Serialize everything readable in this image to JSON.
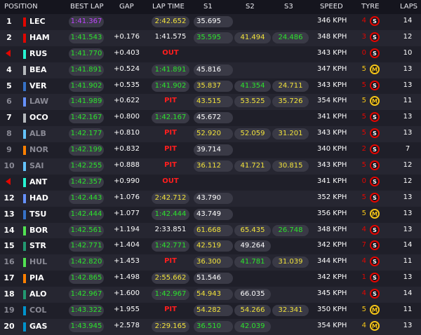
{
  "header": {
    "position": "POSITION",
    "best_lap": "BEST LAP",
    "gap": "GAP",
    "lap_time": "LAP TIME",
    "s1": "S1",
    "s2": "S2",
    "s3": "S3",
    "speed": "SPEED",
    "tyre": "TYRE",
    "laps": "LAPS"
  },
  "colors": {
    "ferrari": "#e10600",
    "mercedes": "#27f4d2",
    "haas": "#b6babd",
    "redbull": "#3671c6",
    "williams": "#64c4ff",
    "racingbulls": "#6692ff",
    "alpine": "#0093cc",
    "mclaren": "#ff8000",
    "astonmartin": "#229971",
    "sauber": "#52e252"
  },
  "rows": [
    {
      "pos": "1",
      "driver": "LEC",
      "team": "ferrari",
      "best": "1:41.367",
      "best_color": "purple",
      "gap": "",
      "lap_time": "2:42.652",
      "lap_color": "yellow",
      "status": "",
      "s1": "35.695",
      "s1_color": "white",
      "s2": "",
      "s2_color": "white",
      "s3": "",
      "s3_color": "white",
      "speed": "346 KPH",
      "tyre_age": "4",
      "tyre_age_color": "#e10600",
      "tyre": "S",
      "laps": "14",
      "grey": false,
      "out": false
    },
    {
      "pos": "2",
      "driver": "HAM",
      "team": "ferrari",
      "best": "1:41.543",
      "best_color": "green",
      "gap": "+0.176",
      "lap_time": "1:41.575",
      "lap_color": "white",
      "status": "",
      "s1": "35.595",
      "s1_color": "green",
      "s2": "41.494",
      "s2_color": "yellow",
      "s3": "24.486",
      "s3_color": "green",
      "speed": "348 KPH",
      "tyre_age": "3",
      "tyre_age_color": "#e10600",
      "tyre": "S",
      "laps": "12",
      "grey": false,
      "out": false
    },
    {
      "pos": "",
      "driver": "RUS",
      "team": "mercedes",
      "best": "1:41.770",
      "best_color": "green",
      "gap": "+0.403",
      "lap_time": "",
      "lap_color": "white",
      "status": "OUT",
      "s1": "",
      "s1_color": "white",
      "s2": "",
      "s2_color": "white",
      "s3": "",
      "s3_color": "white",
      "speed": "343 KPH",
      "tyre_age": "0",
      "tyre_age_color": "#e10600",
      "tyre": "S",
      "laps": "10",
      "grey": false,
      "out": true
    },
    {
      "pos": "4",
      "driver": "BEA",
      "team": "haas",
      "best": "1:41.891",
      "best_color": "green",
      "gap": "+0.524",
      "lap_time": "1:41.891",
      "lap_color": "green",
      "status": "",
      "s1": "45.816",
      "s1_color": "white",
      "s2": "",
      "s2_color": "white",
      "s3": "",
      "s3_color": "white",
      "speed": "347 KPH",
      "tyre_age": "5",
      "tyre_age_color": "#f5c518",
      "tyre": "M",
      "laps": "13",
      "grey": false,
      "out": false
    },
    {
      "pos": "5",
      "driver": "VER",
      "team": "redbull",
      "best": "1:41.902",
      "best_color": "green",
      "gap": "+0.535",
      "lap_time": "1:41.902",
      "lap_color": "green",
      "status": "",
      "s1": "35.837",
      "s1_color": "yellow",
      "s2": "41.354",
      "s2_color": "green",
      "s3": "24.711",
      "s3_color": "yellow",
      "speed": "343 KPH",
      "tyre_age": "5",
      "tyre_age_color": "#e10600",
      "tyre": "S",
      "laps": "13",
      "grey": false,
      "out": false
    },
    {
      "pos": "6",
      "driver": "LAW",
      "team": "racingbulls",
      "best": "1:41.989",
      "best_color": "green",
      "gap": "+0.622",
      "lap_time": "",
      "lap_color": "white",
      "status": "PIT",
      "s1": "43.515",
      "s1_color": "yellow",
      "s2": "53.525",
      "s2_color": "yellow",
      "s3": "35.726",
      "s3_color": "yellow",
      "speed": "354 KPH",
      "tyre_age": "5",
      "tyre_age_color": "#f5c518",
      "tyre": "M",
      "laps": "11",
      "grey": true,
      "out": false
    },
    {
      "pos": "7",
      "driver": "OCO",
      "team": "haas",
      "best": "1:42.167",
      "best_color": "green",
      "gap": "+0.800",
      "lap_time": "1:42.167",
      "lap_color": "green",
      "status": "",
      "s1": "45.672",
      "s1_color": "white",
      "s2": "",
      "s2_color": "white",
      "s3": "",
      "s3_color": "white",
      "speed": "341 KPH",
      "tyre_age": "5",
      "tyre_age_color": "#e10600",
      "tyre": "S",
      "laps": "13",
      "grey": false,
      "out": false
    },
    {
      "pos": "8",
      "driver": "ALB",
      "team": "williams",
      "best": "1:42.177",
      "best_color": "green",
      "gap": "+0.810",
      "lap_time": "",
      "lap_color": "white",
      "status": "PIT",
      "s1": "52.920",
      "s1_color": "yellow",
      "s2": "52.059",
      "s2_color": "yellow",
      "s3": "31.201",
      "s3_color": "yellow",
      "speed": "343 KPH",
      "tyre_age": "5",
      "tyre_age_color": "#e10600",
      "tyre": "S",
      "laps": "13",
      "grey": true,
      "out": false
    },
    {
      "pos": "9",
      "driver": "NOR",
      "team": "mclaren",
      "best": "1:42.199",
      "best_color": "green",
      "gap": "+0.832",
      "lap_time": "",
      "lap_color": "white",
      "status": "PIT",
      "s1": "39.714",
      "s1_color": "white",
      "s2": "",
      "s2_color": "white",
      "s3": "",
      "s3_color": "white",
      "speed": "340 KPH",
      "tyre_age": "2",
      "tyre_age_color": "#e10600",
      "tyre": "S",
      "laps": "7",
      "grey": true,
      "out": false
    },
    {
      "pos": "10",
      "driver": "SAI",
      "team": "williams",
      "best": "1:42.255",
      "best_color": "green",
      "gap": "+0.888",
      "lap_time": "",
      "lap_color": "white",
      "status": "PIT",
      "s1": "36.112",
      "s1_color": "yellow",
      "s2": "41.721",
      "s2_color": "yellow",
      "s3": "30.815",
      "s3_color": "yellow",
      "speed": "343 KPH",
      "tyre_age": "5",
      "tyre_age_color": "#e10600",
      "tyre": "S",
      "laps": "12",
      "grey": true,
      "out": false
    },
    {
      "pos": "",
      "driver": "ANT",
      "team": "mercedes",
      "best": "1:42.357",
      "best_color": "green",
      "gap": "+0.990",
      "lap_time": "",
      "lap_color": "white",
      "status": "OUT",
      "s1": "",
      "s1_color": "white",
      "s2": "",
      "s2_color": "white",
      "s3": "",
      "s3_color": "white",
      "speed": "341 KPH",
      "tyre_age": "0",
      "tyre_age_color": "#e10600",
      "tyre": "S",
      "laps": "12",
      "grey": false,
      "out": true
    },
    {
      "pos": "12",
      "driver": "HAD",
      "team": "racingbulls",
      "best": "1:42.443",
      "best_color": "green",
      "gap": "+1.076",
      "lap_time": "2:42.712",
      "lap_color": "yellow",
      "status": "",
      "s1": "43.790",
      "s1_color": "white",
      "s2": "",
      "s2_color": "white",
      "s3": "",
      "s3_color": "white",
      "speed": "352 KPH",
      "tyre_age": "5",
      "tyre_age_color": "#e10600",
      "tyre": "S",
      "laps": "13",
      "grey": false,
      "out": false
    },
    {
      "pos": "13",
      "driver": "TSU",
      "team": "redbull",
      "best": "1:42.444",
      "best_color": "green",
      "gap": "+1.077",
      "lap_time": "1:42.444",
      "lap_color": "green",
      "status": "",
      "s1": "43.749",
      "s1_color": "white",
      "s2": "",
      "s2_color": "white",
      "s3": "",
      "s3_color": "white",
      "speed": "356 KPH",
      "tyre_age": "5",
      "tyre_age_color": "#f5c518",
      "tyre": "M",
      "laps": "13",
      "grey": false,
      "out": false
    },
    {
      "pos": "14",
      "driver": "BOR",
      "team": "sauber",
      "best": "1:42.561",
      "best_color": "green",
      "gap": "+1.194",
      "lap_time": "2:33.851",
      "lap_color": "white",
      "status": "",
      "s1": "61.668",
      "s1_color": "yellow",
      "s2": "65.435",
      "s2_color": "yellow",
      "s3": "26.748",
      "s3_color": "green",
      "speed": "348 KPH",
      "tyre_age": "4",
      "tyre_age_color": "#e10600",
      "tyre": "S",
      "laps": "13",
      "grey": false,
      "out": false
    },
    {
      "pos": "15",
      "driver": "STR",
      "team": "astonmartin",
      "best": "1:42.771",
      "best_color": "green",
      "gap": "+1.404",
      "lap_time": "1:42.771",
      "lap_color": "green",
      "status": "",
      "s1": "42.519",
      "s1_color": "yellow",
      "s2": "49.264",
      "s2_color": "white",
      "s3": "",
      "s3_color": "white",
      "speed": "342 KPH",
      "tyre_age": "7",
      "tyre_age_color": "#e10600",
      "tyre": "S",
      "laps": "14",
      "grey": false,
      "out": false
    },
    {
      "pos": "16",
      "driver": "HUL",
      "team": "sauber",
      "best": "1:42.820",
      "best_color": "green",
      "gap": "+1.453",
      "lap_time": "",
      "lap_color": "white",
      "status": "PIT",
      "s1": "36.300",
      "s1_color": "yellow",
      "s2": "41.781",
      "s2_color": "green",
      "s3": "31.039",
      "s3_color": "yellow",
      "speed": "344 KPH",
      "tyre_age": "4",
      "tyre_age_color": "#e10600",
      "tyre": "S",
      "laps": "11",
      "grey": true,
      "out": false
    },
    {
      "pos": "17",
      "driver": "PIA",
      "team": "mclaren",
      "best": "1:42.865",
      "best_color": "green",
      "gap": "+1.498",
      "lap_time": "2:55.662",
      "lap_color": "yellow",
      "status": "",
      "s1": "51.546",
      "s1_color": "white",
      "s2": "",
      "s2_color": "white",
      "s3": "",
      "s3_color": "white",
      "speed": "342 KPH",
      "tyre_age": "1",
      "tyre_age_color": "#e10600",
      "tyre": "S",
      "laps": "13",
      "grey": false,
      "out": false
    },
    {
      "pos": "18",
      "driver": "ALO",
      "team": "astonmartin",
      "best": "1:42.967",
      "best_color": "green",
      "gap": "+1.600",
      "lap_time": "1:42.967",
      "lap_color": "green",
      "status": "",
      "s1": "54.943",
      "s1_color": "yellow",
      "s2": "66.035",
      "s2_color": "white",
      "s3": "",
      "s3_color": "white",
      "speed": "345 KPH",
      "tyre_age": "4",
      "tyre_age_color": "#e10600",
      "tyre": "S",
      "laps": "14",
      "grey": false,
      "out": false
    },
    {
      "pos": "19",
      "driver": "COL",
      "team": "alpine",
      "best": "1:43.322",
      "best_color": "green",
      "gap": "+1.955",
      "lap_time": "",
      "lap_color": "white",
      "status": "PIT",
      "s1": "54.282",
      "s1_color": "yellow",
      "s2": "54.266",
      "s2_color": "yellow",
      "s3": "32.341",
      "s3_color": "yellow",
      "speed": "350 KPH",
      "tyre_age": "5",
      "tyre_age_color": "#f5c518",
      "tyre": "M",
      "laps": "11",
      "grey": true,
      "out": false
    },
    {
      "pos": "20",
      "driver": "GAS",
      "team": "alpine",
      "best": "1:43.945",
      "best_color": "green",
      "gap": "+2.578",
      "lap_time": "2:29.165",
      "lap_color": "yellow",
      "status": "",
      "s1": "36.510",
      "s1_color": "green",
      "s2": "42.039",
      "s2_color": "green",
      "s3": "",
      "s3_color": "white",
      "speed": "354 KPH",
      "tyre_age": "4",
      "tyre_age_color": "#f5c518",
      "tyre": "M",
      "laps": "13",
      "grey": false,
      "out": false
    }
  ]
}
